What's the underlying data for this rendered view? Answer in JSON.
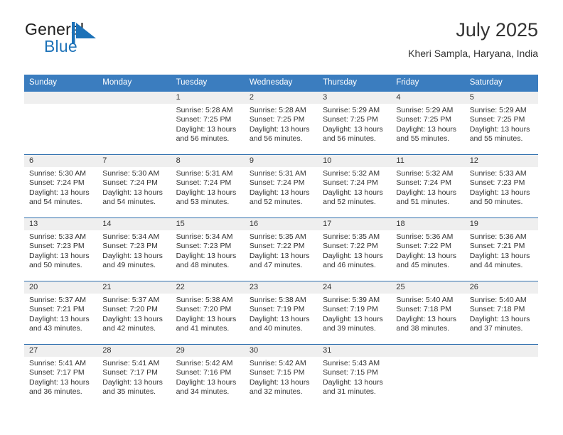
{
  "brand": {
    "name_part1": "General",
    "name_part2": "Blue",
    "mark_icon": "triangle-flag-icon",
    "colors": {
      "blue": "#1d72b8",
      "dark": "#1d1d1d"
    }
  },
  "header": {
    "title": "July 2025",
    "subtitle": "Kheri Sampla, Haryana, India"
  },
  "theme": {
    "header_blue": "#3b7dbf",
    "row_divider": "#2f6fae",
    "day_band_gray": "#efefef",
    "text": "#333333"
  },
  "weekdays": [
    "Sunday",
    "Monday",
    "Tuesday",
    "Wednesday",
    "Thursday",
    "Friday",
    "Saturday"
  ],
  "weeks": [
    [
      {
        "empty": true,
        "day": ""
      },
      {
        "empty": true,
        "day": ""
      },
      {
        "day": "1",
        "sunrise": "Sunrise: 5:28 AM",
        "sunset": "Sunset: 7:25 PM",
        "daylight": "Daylight: 13 hours and 56 minutes."
      },
      {
        "day": "2",
        "sunrise": "Sunrise: 5:28 AM",
        "sunset": "Sunset: 7:25 PM",
        "daylight": "Daylight: 13 hours and 56 minutes."
      },
      {
        "day": "3",
        "sunrise": "Sunrise: 5:29 AM",
        "sunset": "Sunset: 7:25 PM",
        "daylight": "Daylight: 13 hours and 56 minutes."
      },
      {
        "day": "4",
        "sunrise": "Sunrise: 5:29 AM",
        "sunset": "Sunset: 7:25 PM",
        "daylight": "Daylight: 13 hours and 55 minutes."
      },
      {
        "day": "5",
        "sunrise": "Sunrise: 5:29 AM",
        "sunset": "Sunset: 7:25 PM",
        "daylight": "Daylight: 13 hours and 55 minutes."
      }
    ],
    [
      {
        "day": "6",
        "sunrise": "Sunrise: 5:30 AM",
        "sunset": "Sunset: 7:24 PM",
        "daylight": "Daylight: 13 hours and 54 minutes."
      },
      {
        "day": "7",
        "sunrise": "Sunrise: 5:30 AM",
        "sunset": "Sunset: 7:24 PM",
        "daylight": "Daylight: 13 hours and 54 minutes."
      },
      {
        "day": "8",
        "sunrise": "Sunrise: 5:31 AM",
        "sunset": "Sunset: 7:24 PM",
        "daylight": "Daylight: 13 hours and 53 minutes."
      },
      {
        "day": "9",
        "sunrise": "Sunrise: 5:31 AM",
        "sunset": "Sunset: 7:24 PM",
        "daylight": "Daylight: 13 hours and 52 minutes."
      },
      {
        "day": "10",
        "sunrise": "Sunrise: 5:32 AM",
        "sunset": "Sunset: 7:24 PM",
        "daylight": "Daylight: 13 hours and 52 minutes."
      },
      {
        "day": "11",
        "sunrise": "Sunrise: 5:32 AM",
        "sunset": "Sunset: 7:24 PM",
        "daylight": "Daylight: 13 hours and 51 minutes."
      },
      {
        "day": "12",
        "sunrise": "Sunrise: 5:33 AM",
        "sunset": "Sunset: 7:23 PM",
        "daylight": "Daylight: 13 hours and 50 minutes."
      }
    ],
    [
      {
        "day": "13",
        "sunrise": "Sunrise: 5:33 AM",
        "sunset": "Sunset: 7:23 PM",
        "daylight": "Daylight: 13 hours and 50 minutes."
      },
      {
        "day": "14",
        "sunrise": "Sunrise: 5:34 AM",
        "sunset": "Sunset: 7:23 PM",
        "daylight": "Daylight: 13 hours and 49 minutes."
      },
      {
        "day": "15",
        "sunrise": "Sunrise: 5:34 AM",
        "sunset": "Sunset: 7:23 PM",
        "daylight": "Daylight: 13 hours and 48 minutes."
      },
      {
        "day": "16",
        "sunrise": "Sunrise: 5:35 AM",
        "sunset": "Sunset: 7:22 PM",
        "daylight": "Daylight: 13 hours and 47 minutes."
      },
      {
        "day": "17",
        "sunrise": "Sunrise: 5:35 AM",
        "sunset": "Sunset: 7:22 PM",
        "daylight": "Daylight: 13 hours and 46 minutes."
      },
      {
        "day": "18",
        "sunrise": "Sunrise: 5:36 AM",
        "sunset": "Sunset: 7:22 PM",
        "daylight": "Daylight: 13 hours and 45 minutes."
      },
      {
        "day": "19",
        "sunrise": "Sunrise: 5:36 AM",
        "sunset": "Sunset: 7:21 PM",
        "daylight": "Daylight: 13 hours and 44 minutes."
      }
    ],
    [
      {
        "day": "20",
        "sunrise": "Sunrise: 5:37 AM",
        "sunset": "Sunset: 7:21 PM",
        "daylight": "Daylight: 13 hours and 43 minutes."
      },
      {
        "day": "21",
        "sunrise": "Sunrise: 5:37 AM",
        "sunset": "Sunset: 7:20 PM",
        "daylight": "Daylight: 13 hours and 42 minutes."
      },
      {
        "day": "22",
        "sunrise": "Sunrise: 5:38 AM",
        "sunset": "Sunset: 7:20 PM",
        "daylight": "Daylight: 13 hours and 41 minutes."
      },
      {
        "day": "23",
        "sunrise": "Sunrise: 5:38 AM",
        "sunset": "Sunset: 7:19 PM",
        "daylight": "Daylight: 13 hours and 40 minutes."
      },
      {
        "day": "24",
        "sunrise": "Sunrise: 5:39 AM",
        "sunset": "Sunset: 7:19 PM",
        "daylight": "Daylight: 13 hours and 39 minutes."
      },
      {
        "day": "25",
        "sunrise": "Sunrise: 5:40 AM",
        "sunset": "Sunset: 7:18 PM",
        "daylight": "Daylight: 13 hours and 38 minutes."
      },
      {
        "day": "26",
        "sunrise": "Sunrise: 5:40 AM",
        "sunset": "Sunset: 7:18 PM",
        "daylight": "Daylight: 13 hours and 37 minutes."
      }
    ],
    [
      {
        "day": "27",
        "sunrise": "Sunrise: 5:41 AM",
        "sunset": "Sunset: 7:17 PM",
        "daylight": "Daylight: 13 hours and 36 minutes."
      },
      {
        "day": "28",
        "sunrise": "Sunrise: 5:41 AM",
        "sunset": "Sunset: 7:17 PM",
        "daylight": "Daylight: 13 hours and 35 minutes."
      },
      {
        "day": "29",
        "sunrise": "Sunrise: 5:42 AM",
        "sunset": "Sunset: 7:16 PM",
        "daylight": "Daylight: 13 hours and 34 minutes."
      },
      {
        "day": "30",
        "sunrise": "Sunrise: 5:42 AM",
        "sunset": "Sunset: 7:15 PM",
        "daylight": "Daylight: 13 hours and 32 minutes."
      },
      {
        "day": "31",
        "sunrise": "Sunrise: 5:43 AM",
        "sunset": "Sunset: 7:15 PM",
        "daylight": "Daylight: 13 hours and 31 minutes."
      },
      {
        "empty": true,
        "day": ""
      },
      {
        "empty": true,
        "day": ""
      }
    ]
  ]
}
